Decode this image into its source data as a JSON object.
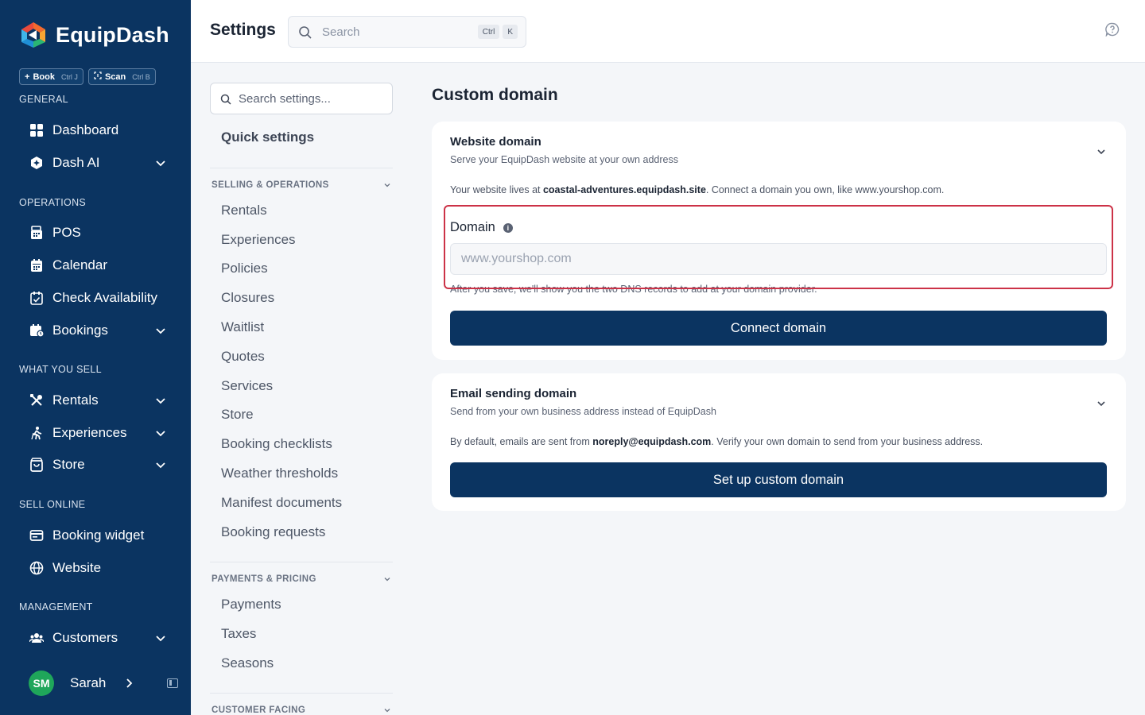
{
  "app": {
    "name": "EquipDash"
  },
  "quick_actions": [
    {
      "label": "Book",
      "prefix": "+",
      "shortcut": "Ctrl J"
    },
    {
      "label": "Scan",
      "shortcut": "Ctrl B"
    }
  ],
  "sidebar": {
    "sections": [
      {
        "title": "GENERAL",
        "items": [
          {
            "label": "Dashboard",
            "icon": "grid-icon",
            "expandable": false
          },
          {
            "label": "Dash AI",
            "icon": "ai-icon",
            "expandable": true
          }
        ]
      },
      {
        "title": "OPERATIONS",
        "items": [
          {
            "label": "POS",
            "icon": "pos-icon",
            "expandable": false
          },
          {
            "label": "Calendar",
            "icon": "calendar-icon",
            "expandable": false
          },
          {
            "label": "Check Availability",
            "icon": "calendar-check-icon",
            "expandable": false
          },
          {
            "label": "Bookings",
            "icon": "bookings-icon",
            "expandable": true
          }
        ]
      },
      {
        "title": "WHAT YOU SELL",
        "items": [
          {
            "label": "Rentals",
            "icon": "tools-icon",
            "expandable": true
          },
          {
            "label": "Experiences",
            "icon": "hiker-icon",
            "expandable": true
          },
          {
            "label": "Store",
            "icon": "shopping-bag-icon",
            "expandable": true
          }
        ]
      },
      {
        "title": "SELL ONLINE",
        "items": [
          {
            "label": "Booking widget",
            "icon": "widget-icon",
            "expandable": false
          },
          {
            "label": "Website",
            "icon": "globe-icon",
            "expandable": false
          }
        ]
      },
      {
        "title": "MANAGEMENT",
        "items": [
          {
            "label": "Customers",
            "icon": "users-icon",
            "expandable": true
          }
        ]
      }
    ],
    "user": {
      "initials": "SM",
      "name": "Sarah"
    }
  },
  "topbar": {
    "title": "Settings",
    "search_placeholder": "Search",
    "shortcut_keys": [
      "Ctrl",
      "K"
    ]
  },
  "settings_nav": {
    "search_placeholder": "Search settings...",
    "quick_settings": "Quick settings",
    "groups": [
      {
        "title": "SELLING & OPERATIONS",
        "items": [
          "Rentals",
          "Experiences",
          "Policies",
          "Closures",
          "Waitlist",
          "Quotes",
          "Services",
          "Store",
          "Booking checklists",
          "Weather thresholds",
          "Manifest documents",
          "Booking requests"
        ]
      },
      {
        "title": "PAYMENTS & PRICING",
        "items": [
          "Payments",
          "Taxes",
          "Seasons"
        ]
      },
      {
        "title": "CUSTOMER FACING",
        "items": []
      }
    ]
  },
  "main": {
    "title": "Custom domain",
    "website_domain": {
      "title": "Website domain",
      "subtitle": "Serve your EquipDash website at your own address",
      "info_prefix": "Your website lives at ",
      "current_site": "coastal-adventures.equipdash.site",
      "info_suffix": ". Connect a domain you own, like www.yourshop.com.",
      "field_label": "Domain",
      "field_value": "",
      "field_placeholder": "www.yourshop.com",
      "hint": "After you save, we'll show you the two DNS records to add at your domain provider.",
      "button": "Connect domain"
    },
    "email_domain": {
      "title": "Email sending domain",
      "subtitle": "Send from your own business address instead of EquipDash",
      "info_prefix": "By default, emails are sent from ",
      "sender": "noreply@equipdash.com",
      "info_suffix": ". Verify your own domain to send from your business address.",
      "button": "Set up custom domain"
    }
  },
  "colors": {
    "sidebar_bg": "#0b3461",
    "primary_button": "#0b3461",
    "highlight_border": "#cc3247",
    "avatar_bg": "#1fa65a"
  }
}
